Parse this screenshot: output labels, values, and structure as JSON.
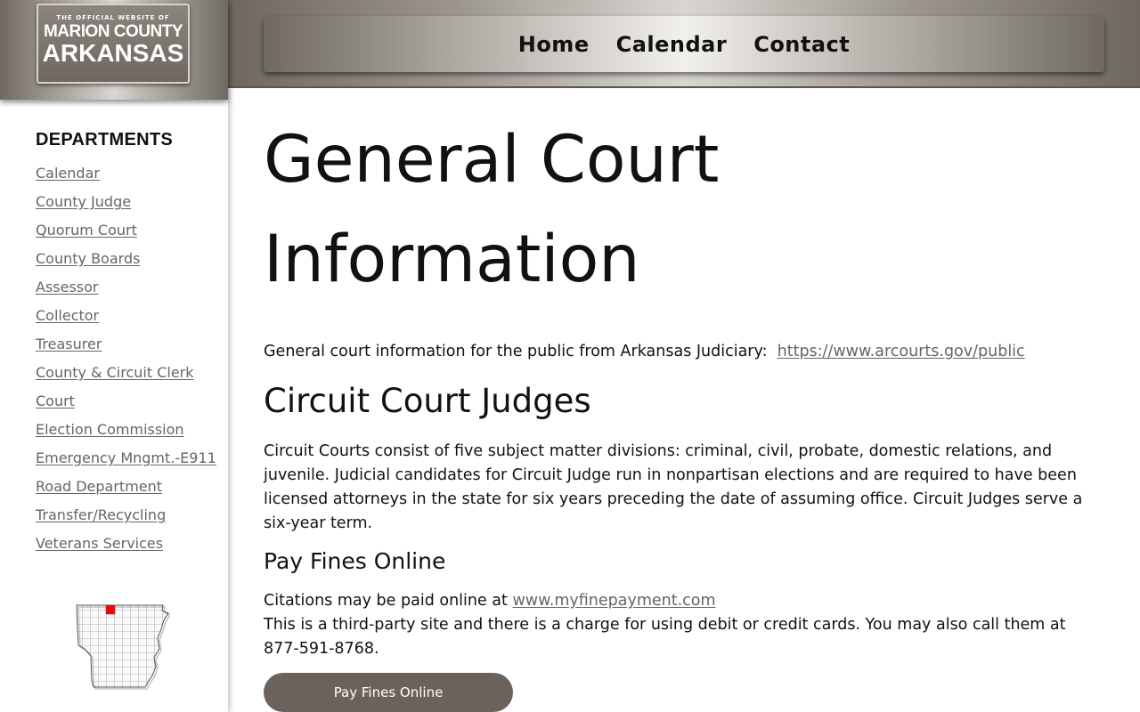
{
  "logo": {
    "tagline": "THE OFFICIAL WEBSITE OF",
    "line1": "MARION COUNTY",
    "line2": "ARKANSAS"
  },
  "nav": {
    "items": [
      {
        "label": "Home"
      },
      {
        "label": "Calendar"
      },
      {
        "label": "Contact"
      }
    ]
  },
  "sidebar": {
    "heading": "DEPARTMENTS",
    "items": [
      {
        "label": "Calendar"
      },
      {
        "label": "County Judge"
      },
      {
        "label": "Quorum Court"
      },
      {
        "label": "County Boards"
      },
      {
        "label": "Assessor"
      },
      {
        "label": "Collector"
      },
      {
        "label": "Treasurer"
      },
      {
        "label": "County & Circuit Clerk"
      },
      {
        "label": "Court"
      },
      {
        "label": "Election Commission"
      },
      {
        "label": "Emergency Mngmt.-E911"
      },
      {
        "label": "Road Department"
      },
      {
        "label": "Transfer/Recycling"
      },
      {
        "label": "Veterans Services"
      }
    ]
  },
  "main": {
    "title_line1": "General Court",
    "title_line2": "Information",
    "intro_text": "General court information for the public from Arkansas Judiciary:",
    "intro_link": "https://www.arcourts.gov/public",
    "judges_heading": "Circuit Court Judges",
    "judges_text": "Circuit Courts consist of five subject matter divisions: criminal, civil, probate, domestic relations, and juvenile. Judicial candidates for Circuit Judge run in nonpartisan elections and are required to have been licensed attorneys in the state for six years preceding the date of assuming office. Circuit Judges serve a six-year term.",
    "fines_heading": "Pay Fines Online",
    "fines_text1": "Citations may be paid online at",
    "fines_link": "www.myfinepayment.com",
    "fines_text2": "This is a third-party site and there is a charge for using debit or credit cards. You may also call them at 877-591-8768.",
    "pay_button": "Pay Fines Online"
  },
  "colors": {
    "accent_button": "#6b635b",
    "link": "#6a6460",
    "highlight_county": "#ff0000"
  }
}
